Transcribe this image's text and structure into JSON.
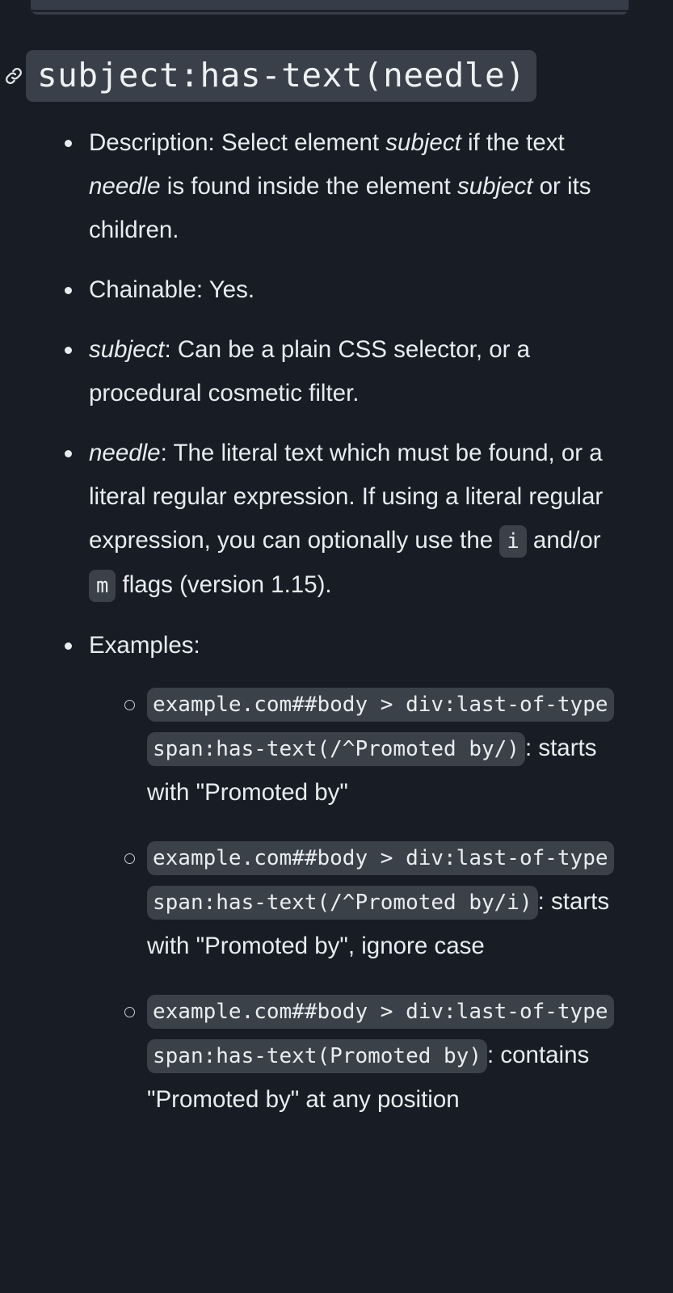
{
  "theme": {
    "background": "#181c25",
    "text_color": "#e9ecef",
    "code_background": "#3b4149",
    "heading_code_background": "#3a4049",
    "code_text": "#eaedf0"
  },
  "heading": {
    "anchor_icon": "link-icon",
    "code_title": "subject:has-text(needle)"
  },
  "bullets": {
    "description": {
      "label": "Description:",
      "text_1": " Select element ",
      "em_1": "subject",
      "text_2": " if the text ",
      "em_2": "needle",
      "text_3": " is found inside the element ",
      "em_3": "subject",
      "text_4": " or its children."
    },
    "chainable": {
      "label": "Chainable:",
      "value": " Yes."
    },
    "subject": {
      "em": "subject",
      "text": ": Can be a plain CSS selector, or a procedural cosmetic filter."
    },
    "needle": {
      "em": "needle",
      "text_1": ": The literal text which must be found, or a literal regular expression. If using a literal regular expression, you can optionally use the ",
      "flag_i": "i",
      "text_2": " and/or ",
      "flag_m": "m",
      "text_3": " flags (version 1.15)."
    },
    "examples": {
      "label": "Examples:",
      "items": [
        {
          "code": "example.com##body > div:last-of-type span:has-text(/^Promoted by/)",
          "description": ": starts with \"Promoted by\""
        },
        {
          "code": "example.com##body > div:last-of-type span:has-text(/^Promoted by/i)",
          "description": ": starts with \"Promoted by\", ignore case"
        },
        {
          "code": "example.com##body > div:last-of-type span:has-text(Promoted by)",
          "description": ": contains \"Promoted by\" at any position"
        }
      ]
    }
  }
}
